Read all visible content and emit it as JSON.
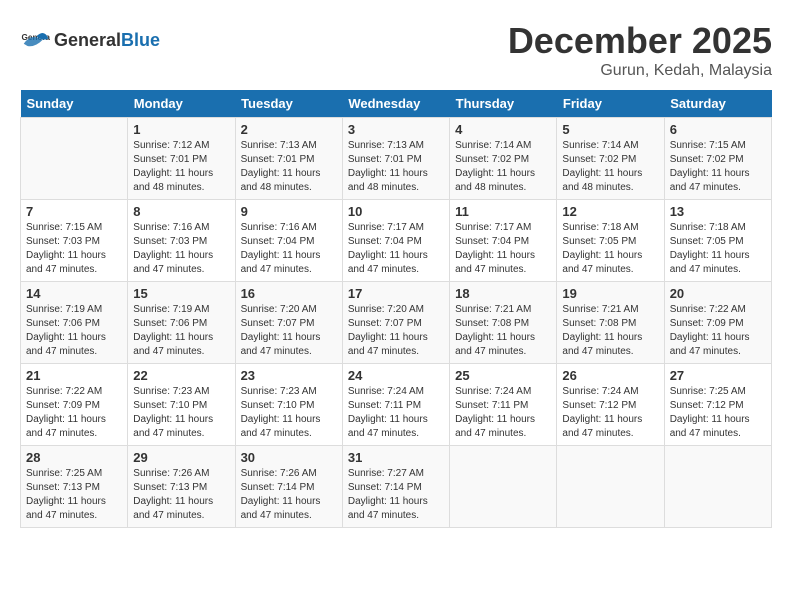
{
  "logo": {
    "text_general": "General",
    "text_blue": "Blue"
  },
  "title": "December 2025",
  "location": "Gurun, Kedah, Malaysia",
  "days_header": [
    "Sunday",
    "Monday",
    "Tuesday",
    "Wednesday",
    "Thursday",
    "Friday",
    "Saturday"
  ],
  "weeks": [
    [
      {
        "day": "",
        "info": ""
      },
      {
        "day": "1",
        "info": "Sunrise: 7:12 AM\nSunset: 7:01 PM\nDaylight: 11 hours\nand 48 minutes."
      },
      {
        "day": "2",
        "info": "Sunrise: 7:13 AM\nSunset: 7:01 PM\nDaylight: 11 hours\nand 48 minutes."
      },
      {
        "day": "3",
        "info": "Sunrise: 7:13 AM\nSunset: 7:01 PM\nDaylight: 11 hours\nand 48 minutes."
      },
      {
        "day": "4",
        "info": "Sunrise: 7:14 AM\nSunset: 7:02 PM\nDaylight: 11 hours\nand 48 minutes."
      },
      {
        "day": "5",
        "info": "Sunrise: 7:14 AM\nSunset: 7:02 PM\nDaylight: 11 hours\nand 48 minutes."
      },
      {
        "day": "6",
        "info": "Sunrise: 7:15 AM\nSunset: 7:02 PM\nDaylight: 11 hours\nand 47 minutes."
      }
    ],
    [
      {
        "day": "7",
        "info": "Sunrise: 7:15 AM\nSunset: 7:03 PM\nDaylight: 11 hours\nand 47 minutes."
      },
      {
        "day": "8",
        "info": "Sunrise: 7:16 AM\nSunset: 7:03 PM\nDaylight: 11 hours\nand 47 minutes."
      },
      {
        "day": "9",
        "info": "Sunrise: 7:16 AM\nSunset: 7:04 PM\nDaylight: 11 hours\nand 47 minutes."
      },
      {
        "day": "10",
        "info": "Sunrise: 7:17 AM\nSunset: 7:04 PM\nDaylight: 11 hours\nand 47 minutes."
      },
      {
        "day": "11",
        "info": "Sunrise: 7:17 AM\nSunset: 7:04 PM\nDaylight: 11 hours\nand 47 minutes."
      },
      {
        "day": "12",
        "info": "Sunrise: 7:18 AM\nSunset: 7:05 PM\nDaylight: 11 hours\nand 47 minutes."
      },
      {
        "day": "13",
        "info": "Sunrise: 7:18 AM\nSunset: 7:05 PM\nDaylight: 11 hours\nand 47 minutes."
      }
    ],
    [
      {
        "day": "14",
        "info": "Sunrise: 7:19 AM\nSunset: 7:06 PM\nDaylight: 11 hours\nand 47 minutes."
      },
      {
        "day": "15",
        "info": "Sunrise: 7:19 AM\nSunset: 7:06 PM\nDaylight: 11 hours\nand 47 minutes."
      },
      {
        "day": "16",
        "info": "Sunrise: 7:20 AM\nSunset: 7:07 PM\nDaylight: 11 hours\nand 47 minutes."
      },
      {
        "day": "17",
        "info": "Sunrise: 7:20 AM\nSunset: 7:07 PM\nDaylight: 11 hours\nand 47 minutes."
      },
      {
        "day": "18",
        "info": "Sunrise: 7:21 AM\nSunset: 7:08 PM\nDaylight: 11 hours\nand 47 minutes."
      },
      {
        "day": "19",
        "info": "Sunrise: 7:21 AM\nSunset: 7:08 PM\nDaylight: 11 hours\nand 47 minutes."
      },
      {
        "day": "20",
        "info": "Sunrise: 7:22 AM\nSunset: 7:09 PM\nDaylight: 11 hours\nand 47 minutes."
      }
    ],
    [
      {
        "day": "21",
        "info": "Sunrise: 7:22 AM\nSunset: 7:09 PM\nDaylight: 11 hours\nand 47 minutes."
      },
      {
        "day": "22",
        "info": "Sunrise: 7:23 AM\nSunset: 7:10 PM\nDaylight: 11 hours\nand 47 minutes."
      },
      {
        "day": "23",
        "info": "Sunrise: 7:23 AM\nSunset: 7:10 PM\nDaylight: 11 hours\nand 47 minutes."
      },
      {
        "day": "24",
        "info": "Sunrise: 7:24 AM\nSunset: 7:11 PM\nDaylight: 11 hours\nand 47 minutes."
      },
      {
        "day": "25",
        "info": "Sunrise: 7:24 AM\nSunset: 7:11 PM\nDaylight: 11 hours\nand 47 minutes."
      },
      {
        "day": "26",
        "info": "Sunrise: 7:24 AM\nSunset: 7:12 PM\nDaylight: 11 hours\nand 47 minutes."
      },
      {
        "day": "27",
        "info": "Sunrise: 7:25 AM\nSunset: 7:12 PM\nDaylight: 11 hours\nand 47 minutes."
      }
    ],
    [
      {
        "day": "28",
        "info": "Sunrise: 7:25 AM\nSunset: 7:13 PM\nDaylight: 11 hours\nand 47 minutes."
      },
      {
        "day": "29",
        "info": "Sunrise: 7:26 AM\nSunset: 7:13 PM\nDaylight: 11 hours\nand 47 minutes."
      },
      {
        "day": "30",
        "info": "Sunrise: 7:26 AM\nSunset: 7:14 PM\nDaylight: 11 hours\nand 47 minutes."
      },
      {
        "day": "31",
        "info": "Sunrise: 7:27 AM\nSunset: 7:14 PM\nDaylight: 11 hours\nand 47 minutes."
      },
      {
        "day": "",
        "info": ""
      },
      {
        "day": "",
        "info": ""
      },
      {
        "day": "",
        "info": ""
      }
    ]
  ]
}
